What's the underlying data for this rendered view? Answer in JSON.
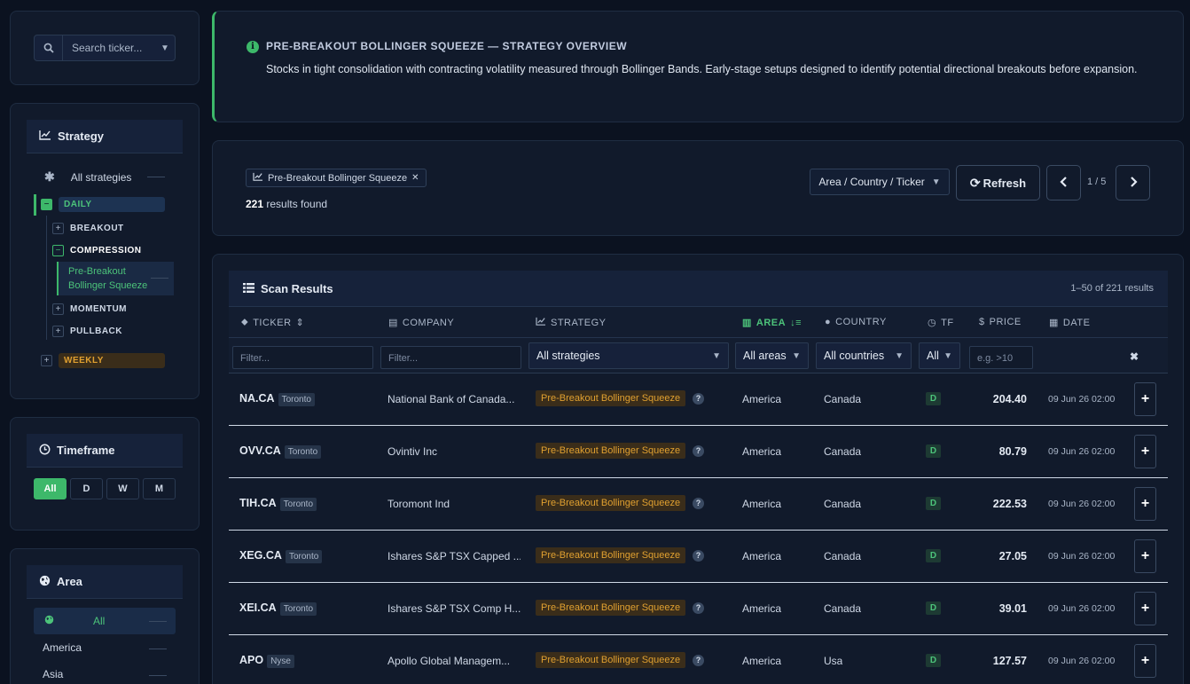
{
  "search": {
    "placeholder": "Search ticker..."
  },
  "strategy": {
    "title": "Strategy",
    "all_label": "All strategies",
    "daily": "DAILY",
    "children": [
      "BREAKOUT",
      "COMPRESSION",
      "MOMENTUM",
      "PULLBACK"
    ],
    "selected_leaf": "Pre-Breakout Bollinger Squeeze",
    "weekly": "WEEKLY"
  },
  "timeframe": {
    "title": "Timeframe",
    "options": [
      "All",
      "D",
      "W",
      "M"
    ],
    "selected": "All"
  },
  "area": {
    "title": "Area",
    "all": "All",
    "items": [
      "America",
      "Asia"
    ]
  },
  "overview": {
    "title": "PRE-BREAKOUT BOLLINGER SQUEEZE — STRATEGY OVERVIEW",
    "description": "Stocks in tight consolidation with contracting volatility measured through Bollinger Bands. Early-stage setups designed to identify potential directional breakouts before expansion."
  },
  "filters": {
    "chip": "Pre-Breakout Bollinger Squeeze",
    "results_count": "221",
    "results_suffix": "results found",
    "group_by": "Area / Country / Ticker",
    "refresh": "Refresh",
    "page": "1 / 5"
  },
  "results": {
    "title": "Scan Results",
    "range": "1–50 of 221 results",
    "columns": [
      "TICKER",
      "COMPANY",
      "STRATEGY",
      "AREA",
      "COUNTRY",
      "TF",
      "PRICE",
      "DATE"
    ],
    "filter_placeholder": "Filter...",
    "strategy_filter": "All strategies",
    "area_filter": "All areas",
    "country_filter": "All countries",
    "tf_filter": "All",
    "price_placeholder": "e.g. >10",
    "rows": [
      {
        "ticker": "NA.CA",
        "exchange": "Toronto",
        "company": "National Bank of Canada...",
        "strategy": "Pre-Breakout Bollinger Squeeze",
        "area": "America",
        "country": "Canada",
        "tf": "D",
        "price": "204.40",
        "date": "09 Jun 26 02:00"
      },
      {
        "ticker": "OVV.CA",
        "exchange": "Toronto",
        "company": "Ovintiv Inc",
        "strategy": "Pre-Breakout Bollinger Squeeze",
        "area": "America",
        "country": "Canada",
        "tf": "D",
        "price": "80.79",
        "date": "09 Jun 26 02:00"
      },
      {
        "ticker": "TIH.CA",
        "exchange": "Toronto",
        "company": "Toromont Ind",
        "strategy": "Pre-Breakout Bollinger Squeeze",
        "area": "America",
        "country": "Canada",
        "tf": "D",
        "price": "222.53",
        "date": "09 Jun 26 02:00"
      },
      {
        "ticker": "XEG.CA",
        "exchange": "Toronto",
        "company": "Ishares S&P TSX Capped ...",
        "strategy": "Pre-Breakout Bollinger Squeeze",
        "area": "America",
        "country": "Canada",
        "tf": "D",
        "price": "27.05",
        "date": "09 Jun 26 02:00"
      },
      {
        "ticker": "XEI.CA",
        "exchange": "Toronto",
        "company": "Ishares S&P TSX Comp H...",
        "strategy": "Pre-Breakout Bollinger Squeeze",
        "area": "America",
        "country": "Canada",
        "tf": "D",
        "price": "39.01",
        "date": "09 Jun 26 02:00"
      },
      {
        "ticker": "APO",
        "exchange": "Nyse",
        "company": "Apollo Global Managem...",
        "strategy": "Pre-Breakout Bollinger Squeeze",
        "area": "America",
        "country": "Usa",
        "tf": "D",
        "price": "127.57",
        "date": "09 Jun 26 02:00"
      }
    ]
  },
  "colors": {
    "accent": "#3db86a",
    "warning": "#e0a030",
    "background": "#0b1220",
    "panel": "#111a2b"
  }
}
